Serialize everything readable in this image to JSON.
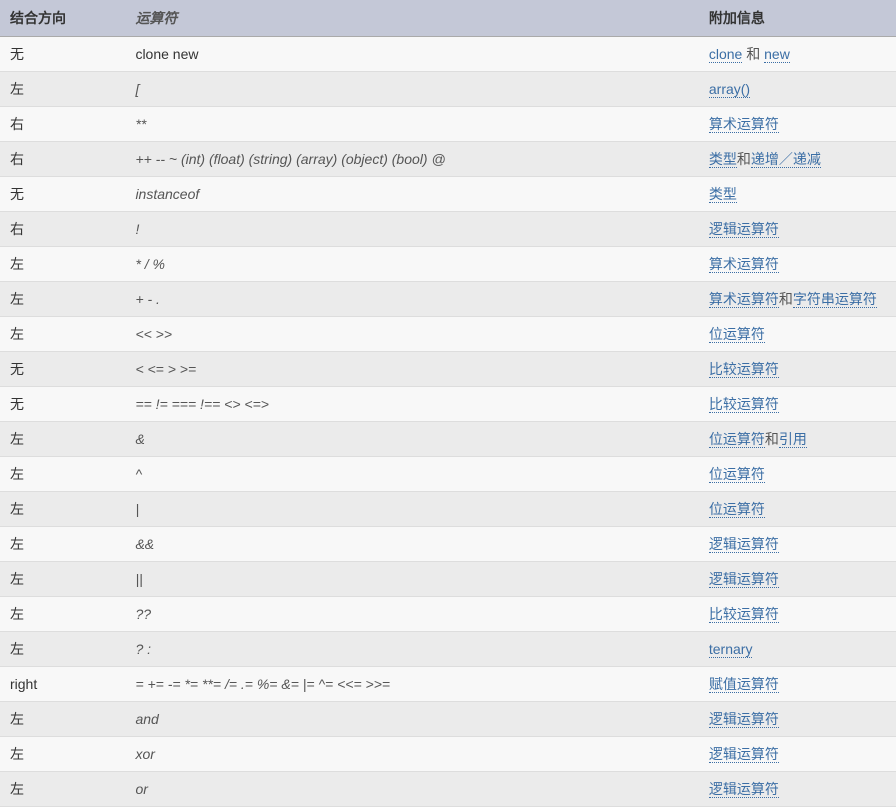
{
  "headers": {
    "associativity": "结合方向",
    "operator": "运算符",
    "info": "附加信息"
  },
  "rows": [
    {
      "assoc": "无",
      "operator": "clone new",
      "op_plain": true,
      "info": [
        {
          "type": "link",
          "text": "clone"
        },
        {
          "type": "text",
          "text": " 和 "
        },
        {
          "type": "link",
          "text": "new"
        }
      ]
    },
    {
      "assoc": "左",
      "operator": "[",
      "info": [
        {
          "type": "link",
          "text": "array()"
        }
      ]
    },
    {
      "assoc": "右",
      "operator": "**",
      "info": [
        {
          "type": "link",
          "text": "算术运算符"
        }
      ]
    },
    {
      "assoc": "右",
      "operator": "++ -- ~ (int) (float) (string) (array) (object) (bool) @",
      "info": [
        {
          "type": "link",
          "text": "类型"
        },
        {
          "type": "text",
          "text": "和"
        },
        {
          "type": "link",
          "text": "递增／递减"
        }
      ]
    },
    {
      "assoc": "无",
      "operator": "instanceof",
      "info": [
        {
          "type": "link",
          "text": "类型"
        }
      ]
    },
    {
      "assoc": "右",
      "operator": "!",
      "info": [
        {
          "type": "link",
          "text": "逻辑运算符"
        }
      ]
    },
    {
      "assoc": "左",
      "operator": "* / %",
      "info": [
        {
          "type": "link",
          "text": "算术运算符"
        }
      ]
    },
    {
      "assoc": "左",
      "operator": "+ - .",
      "info": [
        {
          "type": "link",
          "text": "算术运算符"
        },
        {
          "type": "text",
          "text": "和"
        },
        {
          "type": "link",
          "text": "字符串运算符"
        }
      ]
    },
    {
      "assoc": "左",
      "operator": "<< >>",
      "info": [
        {
          "type": "link",
          "text": "位运算符"
        }
      ]
    },
    {
      "assoc": "无",
      "operator": "< <= > >=",
      "info": [
        {
          "type": "link",
          "text": "比较运算符"
        }
      ]
    },
    {
      "assoc": "无",
      "operator": "== != === !== <> <=>",
      "info": [
        {
          "type": "link",
          "text": "比较运算符"
        }
      ]
    },
    {
      "assoc": "左",
      "operator": "&",
      "info": [
        {
          "type": "link",
          "text": "位运算符"
        },
        {
          "type": "text",
          "text": "和"
        },
        {
          "type": "link",
          "text": "引用"
        }
      ]
    },
    {
      "assoc": "左",
      "operator": "^",
      "info": [
        {
          "type": "link",
          "text": "位运算符"
        }
      ]
    },
    {
      "assoc": "左",
      "operator": "|",
      "info": [
        {
          "type": "link",
          "text": "位运算符"
        }
      ]
    },
    {
      "assoc": "左",
      "operator": "&&",
      "info": [
        {
          "type": "link",
          "text": "逻辑运算符"
        }
      ]
    },
    {
      "assoc": "左",
      "operator": "||",
      "info": [
        {
          "type": "link",
          "text": "逻辑运算符"
        }
      ]
    },
    {
      "assoc": "左",
      "operator": "??",
      "info": [
        {
          "type": "link",
          "text": "比较运算符"
        }
      ]
    },
    {
      "assoc": "左",
      "operator": "? :",
      "info": [
        {
          "type": "link",
          "text": "ternary"
        }
      ]
    },
    {
      "assoc": "right",
      "operator": "= += -= *= **= /= .= %= &= |= ^= <<= >>=",
      "info": [
        {
          "type": "link",
          "text": "赋值运算符"
        }
      ]
    },
    {
      "assoc": "左",
      "operator": "and",
      "info": [
        {
          "type": "link",
          "text": "逻辑运算符"
        }
      ]
    },
    {
      "assoc": "左",
      "operator": "xor",
      "info": [
        {
          "type": "link",
          "text": "逻辑运算符"
        }
      ]
    },
    {
      "assoc": "左",
      "operator": "or",
      "info": [
        {
          "type": "link",
          "text": "逻辑运算符"
        }
      ]
    }
  ]
}
